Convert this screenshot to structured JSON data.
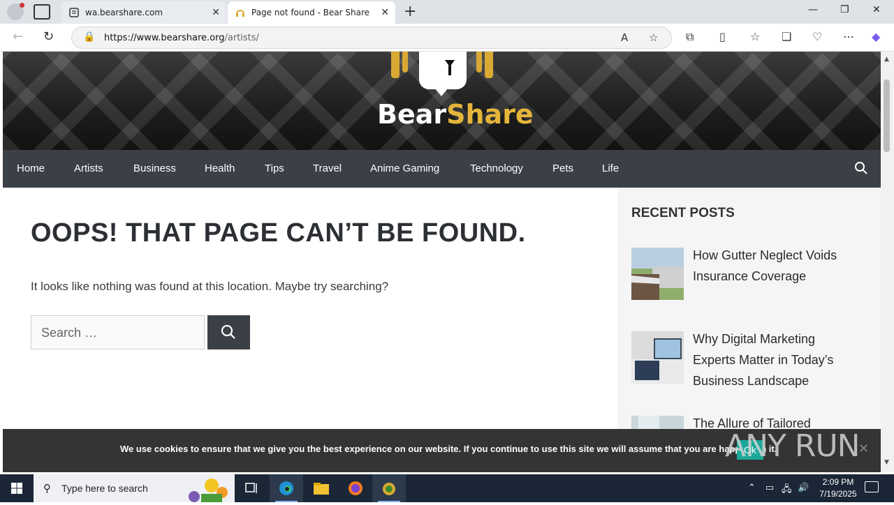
{
  "browser": {
    "tabs": [
      {
        "title": "wa.bearshare.com"
      },
      {
        "title": "Page not found - Bear Share"
      }
    ],
    "url_host": "https://www.bearshare.org",
    "url_path": "/artists/"
  },
  "site": {
    "logo_part1": "Bear",
    "logo_part2": "Share",
    "nav": [
      "Home",
      "Artists",
      "Business",
      "Health",
      "Tips",
      "Travel",
      "Anime Gaming",
      "Technology",
      "Pets",
      "Life"
    ],
    "accent_color": "#e5b53b",
    "nav_bg": "#3b4047"
  },
  "main": {
    "title": "OOPS! THAT PAGE CAN’T BE FOUND.",
    "message": "It looks like nothing was found at this location. Maybe try searching?",
    "search_placeholder": "Search …"
  },
  "sidebar": {
    "heading": "RECENT POSTS",
    "posts": [
      {
        "title": "How Gutter Neglect Voids Insurance Coverage"
      },
      {
        "title": "Why Digital Marketing Experts Matter in Today’s Business Landscape"
      },
      {
        "title": "The Allure of Tailored"
      }
    ]
  },
  "cookie": {
    "message": "We use cookies to ensure that we give you the best experience on our website. If you continue to use this site we will assume that you are happy with it.",
    "ok_label": "Ok",
    "close": "✕"
  },
  "watermark": "ANY RUN",
  "taskbar": {
    "search_placeholder": "Type here to search",
    "time": "2:09 PM",
    "date": "7/19/2025"
  }
}
